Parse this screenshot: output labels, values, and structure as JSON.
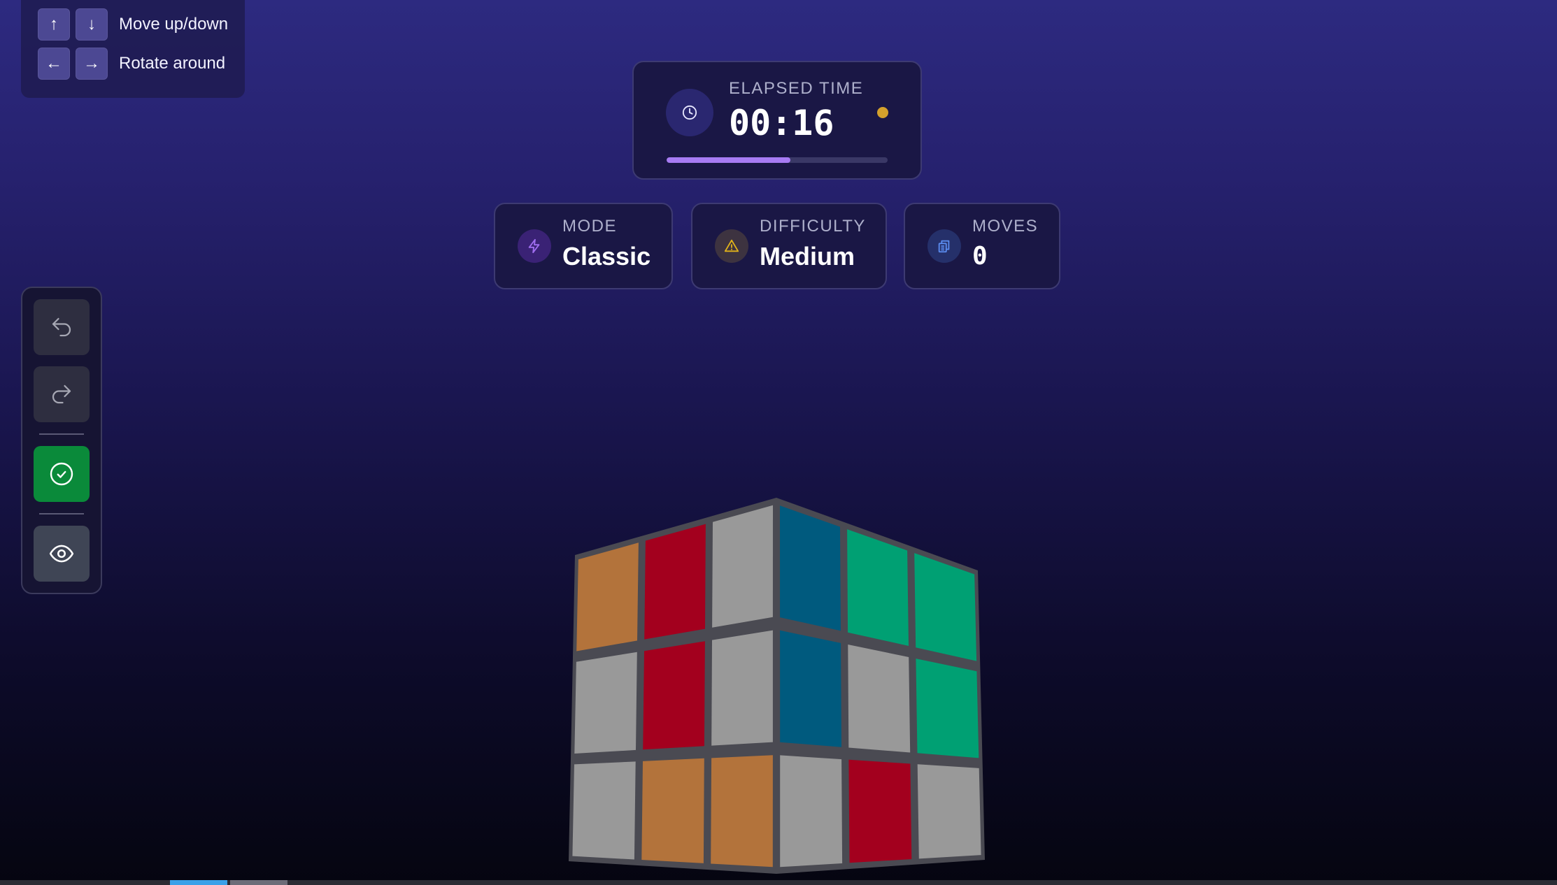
{
  "controls_hint": {
    "rows": [
      {
        "keys": [
          "↑",
          "↓"
        ],
        "label": "Move up/down"
      },
      {
        "keys": [
          "←",
          "→"
        ],
        "label": "Rotate around"
      }
    ]
  },
  "timer": {
    "label": "ELAPSED TIME",
    "value": "00:16",
    "progress": 0.56,
    "status_color": "#d4a12c",
    "icon": "clock-icon"
  },
  "stats": {
    "mode": {
      "label": "MODE",
      "value": "Classic",
      "icon": "lightning-icon",
      "color": "#a06ef0"
    },
    "difficulty": {
      "label": "DIFFICULTY",
      "value": "Medium",
      "icon": "warning-icon",
      "color": "#e0b21a"
    },
    "moves": {
      "label": "MOVES",
      "value": "0",
      "icon": "copy-icon",
      "color": "#5b8cf0"
    }
  },
  "toolbar": {
    "buttons": [
      {
        "name": "undo",
        "icon": "undo-icon"
      },
      {
        "name": "redo",
        "icon": "redo-icon"
      },
      {
        "name": "check",
        "icon": "check-circle-icon",
        "color": "#0a8a3a"
      },
      {
        "name": "view",
        "icon": "eye-icon"
      }
    ]
  },
  "cube": {
    "colors": {
      "white": "#999999",
      "orange": "#b3733b",
      "red": "#a3001e",
      "blue": "#005a7e",
      "green": "#00a073"
    },
    "left_face": [
      [
        "orange",
        "red",
        "white"
      ],
      [
        "white",
        "red",
        "white"
      ],
      [
        "white",
        "orange",
        "orange"
      ]
    ],
    "right_face": [
      [
        "blue",
        "green",
        "green"
      ],
      [
        "blue",
        "white",
        "green"
      ],
      [
        "white",
        "red",
        "white"
      ]
    ]
  }
}
